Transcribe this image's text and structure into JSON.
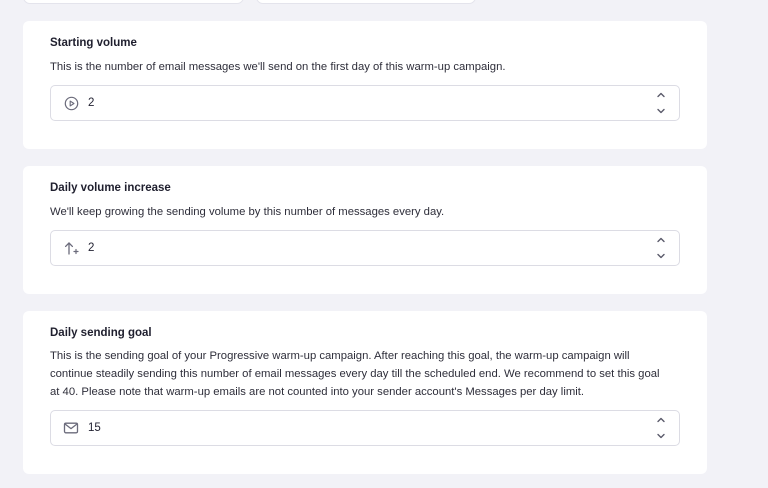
{
  "settings": {
    "starting_volume": {
      "title": "Starting volume",
      "description": "This is the number of email messages we'll send on the first day of this warm-up campaign.",
      "value": "2",
      "icon": "play-circle-icon"
    },
    "daily_increase": {
      "title": "Daily volume increase",
      "description": "We'll keep growing the sending volume by this number of messages every day.",
      "value": "2",
      "icon": "arrow-up-plus-icon"
    },
    "daily_goal": {
      "title": "Daily sending goal",
      "description": "This is the sending goal of your Progressive warm-up campaign. After reaching this goal, the warm-up campaign will continue steadily sending this number of email messages every day till the scheduled end. We recommend to set this goal at 40. Please note that warm-up emails are not counted into your sender account's Messages per day limit.",
      "value": "15",
      "icon": "envelope-icon"
    }
  },
  "colors": {
    "background": "#f2f2f7",
    "card": "#ffffff",
    "border": "#dcdce4",
    "icon": "#6b6b7b"
  }
}
